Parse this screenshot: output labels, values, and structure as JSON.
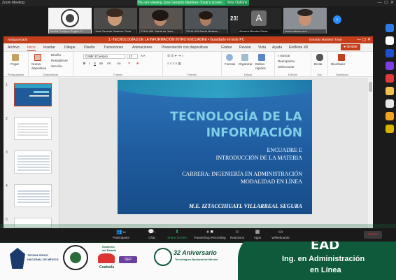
{
  "zoom": {
    "window_title": "Zoom Meeting",
    "view_banner": "You are viewing Jose Gerardo Martinez-Tovar's screen",
    "view_options": "View Options",
    "participants": [
      {
        "name": "TecNM Campus Región C..."
      },
      {
        "name": "José Gerardo Martinez Tovar"
      },
      {
        "name": "231AL493- María de Jesu..."
      },
      {
        "name": "231AL493 Alexia Melissa ..."
      },
      {
        "name": "231AL493-Alexi...",
        "big": "231AL493-Alexi..."
      },
      {
        "name": "Alondra Méndez Pérez",
        "initial": "A"
      },
      {
        "name": "Jesús alberto mol..."
      }
    ],
    "controls": [
      {
        "label": "Participants",
        "count": "16"
      },
      {
        "label": "Chat",
        "count": "5"
      },
      {
        "label": "Share Screen"
      },
      {
        "label": "Pause/Stop Recording"
      },
      {
        "label": "Reactions"
      },
      {
        "label": "Apps"
      },
      {
        "label": "Whiteboards"
      }
    ],
    "leave": "Leave"
  },
  "ppt": {
    "autosave": "Autoguardado",
    "doc_title": "1.-TECNOLOGÍAS DE LA INFORMACIÓN INTRO ENCUADRE  •  Guardado en Este PC",
    "user": "Gerardo Martinez Tovar",
    "tabs": [
      "Archivo",
      "Inicio",
      "Insertar",
      "Dibujar",
      "Diseño",
      "Transiciones",
      "Animaciones",
      "Presentación con diapositivas",
      "Grabar",
      "Revisar",
      "Vista",
      "Ayuda",
      "EndNote X8"
    ],
    "active_tab": "Inicio",
    "record_btn": "Grabar",
    "ribbon": {
      "pegar": "Pegar",
      "nueva": "Nueva diapositiva",
      "diseno": "Diseño",
      "restablecer": "Restablecer",
      "seccion": "Sección",
      "font_name": "Calibri (Cuerpo)",
      "font_size": "12",
      "formas": "Formas",
      "organizar": "Organizar",
      "estilos": "Estilos rápidos",
      "buscar": "Buscar",
      "reemplazar": "Reemplazar",
      "seleccionar": "Seleccionar",
      "dictar": "Dictar",
      "disenador": "Diseñador",
      "groups": [
        "Portapapeles",
        "Diapositivas",
        "Fuente",
        "Párrafo",
        "Dibujo",
        "Edición",
        "Voz",
        "Diseñador"
      ]
    },
    "slide_numbers": [
      "1",
      "2",
      "3",
      "4",
      "5"
    ],
    "slide": {
      "title1": "TECNOLOGÍA DE LA",
      "title2": "INFORMACIÓN",
      "line1": "ENCUADRE E",
      "line2": "INTRODUCCIÓN DE LA MATERIA",
      "line3": "CARRERA: INGENIERÍA EN ADMINISTRACIÓN",
      "line4": "MODALIDAD EN LÍNEA",
      "author": "M.E. IZTACCIHUATL VILLARREAL SEGURA"
    }
  },
  "banner": {
    "ead": "EAD",
    "ing1": "Ing. en Administración",
    "ing2": "en Línea",
    "tec_line1": "TECNOLÓGICO",
    "tec_line2": "NACIONAL DE MÉXICO",
    "gob_line1": "Gobierno",
    "gob_line2": "del Estado",
    "coahuila": "Coahuila",
    "sep": "SEP",
    "aniv": "32 Aniversario",
    "aniv_sub": "Tecnológico Nacional de México"
  },
  "colors": {
    "ppt_accent": "#c43e1c",
    "zoom_green": "#27ae60",
    "slide_blue": "#1e5b9e",
    "banner_green": "#0e5a3a"
  }
}
